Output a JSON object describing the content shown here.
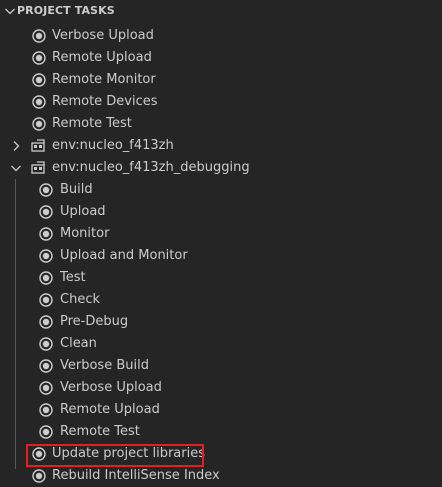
{
  "header": {
    "title": "PROJECT TASKS"
  },
  "tasks_top": [
    {
      "label": "Verbose Upload"
    },
    {
      "label": "Remote Upload"
    },
    {
      "label": "Remote Monitor"
    },
    {
      "label": "Remote Devices"
    },
    {
      "label": "Remote Test"
    }
  ],
  "env_collapsed": {
    "label": "env:nucleo_f413zh",
    "icon": "chevron-right-icon"
  },
  "env_expanded": {
    "label": "env:nucleo_f413zh_debugging",
    "icon": "chevron-down-icon",
    "tasks": [
      {
        "label": "Build"
      },
      {
        "label": "Upload"
      },
      {
        "label": "Monitor"
      },
      {
        "label": "Upload and Monitor"
      },
      {
        "label": "Test"
      },
      {
        "label": "Check"
      },
      {
        "label": "Pre-Debug"
      },
      {
        "label": "Clean"
      },
      {
        "label": "Verbose Build"
      },
      {
        "label": "Verbose Upload"
      },
      {
        "label": "Remote Upload"
      },
      {
        "label": "Remote Test"
      }
    ]
  },
  "general_tasks": [
    {
      "label": "Update project libraries",
      "highlighted": true
    },
    {
      "label": "Rebuild IntelliSense Index"
    }
  ],
  "colors": {
    "background": "#252526",
    "text": "#cccccc",
    "highlight_border": "#e51f1f",
    "tree_guide": "#585858"
  }
}
